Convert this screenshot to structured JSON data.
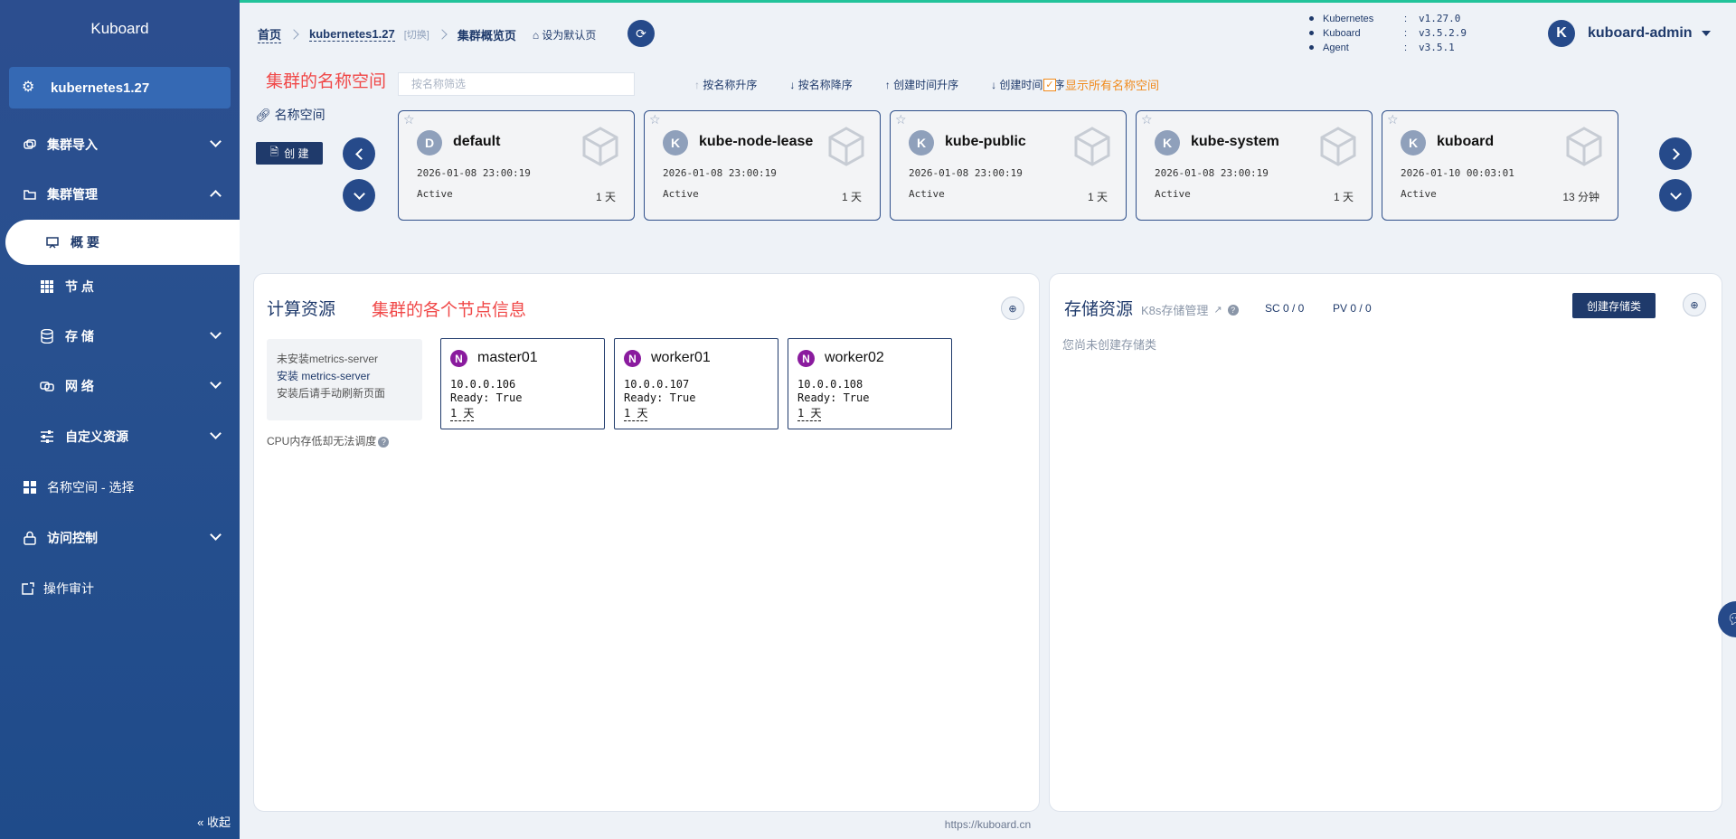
{
  "app": {
    "name": "Kuboard"
  },
  "sidebar": {
    "cluster": "kubernetes1.27",
    "items": [
      {
        "label": "集群导入",
        "icon": "layers-icon"
      },
      {
        "label": "集群管理",
        "icon": "folder-icon"
      },
      {
        "label": "概 要",
        "icon": "monitor-icon"
      },
      {
        "label": "节 点",
        "icon": "grid-icon"
      },
      {
        "label": "存 储",
        "icon": "database-icon"
      },
      {
        "label": "网 络",
        "icon": "network-icon"
      },
      {
        "label": "自定义资源",
        "icon": "sliders-icon"
      },
      {
        "label": "名称空间 - 选择",
        "icon": "apps-icon"
      },
      {
        "label": "访问控制",
        "icon": "lock-icon"
      },
      {
        "label": "操作审计",
        "icon": "audit-icon"
      }
    ],
    "collapse": "收起"
  },
  "header": {
    "breadcrumb": {
      "home": "首页",
      "cluster": "kubernetes1.27",
      "switch": "[切换]",
      "current": "集群概览页"
    },
    "set_default": "设为默认页",
    "versions": [
      {
        "name": "Kubernetes",
        "value": "v1.27.0"
      },
      {
        "name": "Kuboard",
        "value": "v3.5.2.9"
      },
      {
        "name": "Agent",
        "value": "v3.5.1"
      }
    ],
    "user": {
      "avatar": "K",
      "name": "kuboard-admin"
    }
  },
  "annotations": {
    "namespace": "集群的名称空间",
    "nodes": "集群的各个节点信息"
  },
  "namespace_bar": {
    "search_placeholder": "按名称筛选",
    "sorts": [
      "按名称升序",
      "按名称降序",
      "创建时间升序",
      "创建时间降序"
    ],
    "show_all": "显示所有名称空间",
    "label": "名称空间",
    "create": "创 建"
  },
  "namespaces": [
    {
      "letter": "D",
      "name": "default",
      "time": "2026-01-08 23:00:19",
      "status": "Active",
      "age": "1 天"
    },
    {
      "letter": "K",
      "name": "kube-node-lease",
      "time": "2026-01-08 23:00:19",
      "status": "Active",
      "age": "1 天"
    },
    {
      "letter": "K",
      "name": "kube-public",
      "time": "2026-01-08 23:00:19",
      "status": "Active",
      "age": "1 天"
    },
    {
      "letter": "K",
      "name": "kube-system",
      "time": "2026-01-08 23:00:19",
      "status": "Active",
      "age": "1 天"
    },
    {
      "letter": "K",
      "name": "kuboard",
      "time": "2026-01-10 00:03:01",
      "status": "Active",
      "age": "13 分钟"
    }
  ],
  "compute": {
    "title": "计算资源",
    "metrics": {
      "line1": "未安装metrics-server",
      "link": "安装 metrics-server",
      "line3": "安装后请手动刷新页面"
    },
    "cpu_note": "CPU内存低却无法调度",
    "nodes": [
      {
        "badge": "N",
        "name": "master01",
        "ip": "10.0.0.106",
        "ready": "Ready: True",
        "age": "1 天"
      },
      {
        "badge": "N",
        "name": "worker01",
        "ip": "10.0.0.107",
        "ready": "Ready: True",
        "age": "1 天"
      },
      {
        "badge": "N",
        "name": "worker02",
        "ip": "10.0.0.108",
        "ready": "Ready: True",
        "age": "1 天"
      }
    ]
  },
  "storage": {
    "title": "存储资源",
    "link": "K8s存储管理",
    "sc": "SC 0 / 0",
    "pv": "PV 0 / 0",
    "create": "创建存储类",
    "empty": "您尚未创建存储类"
  },
  "footer": "https://kuboard.cn",
  "colors": {
    "primary": "#1f3a6b",
    "accent": "#22c39a",
    "annotation": "#f04848",
    "warning": "#f08a1c"
  }
}
